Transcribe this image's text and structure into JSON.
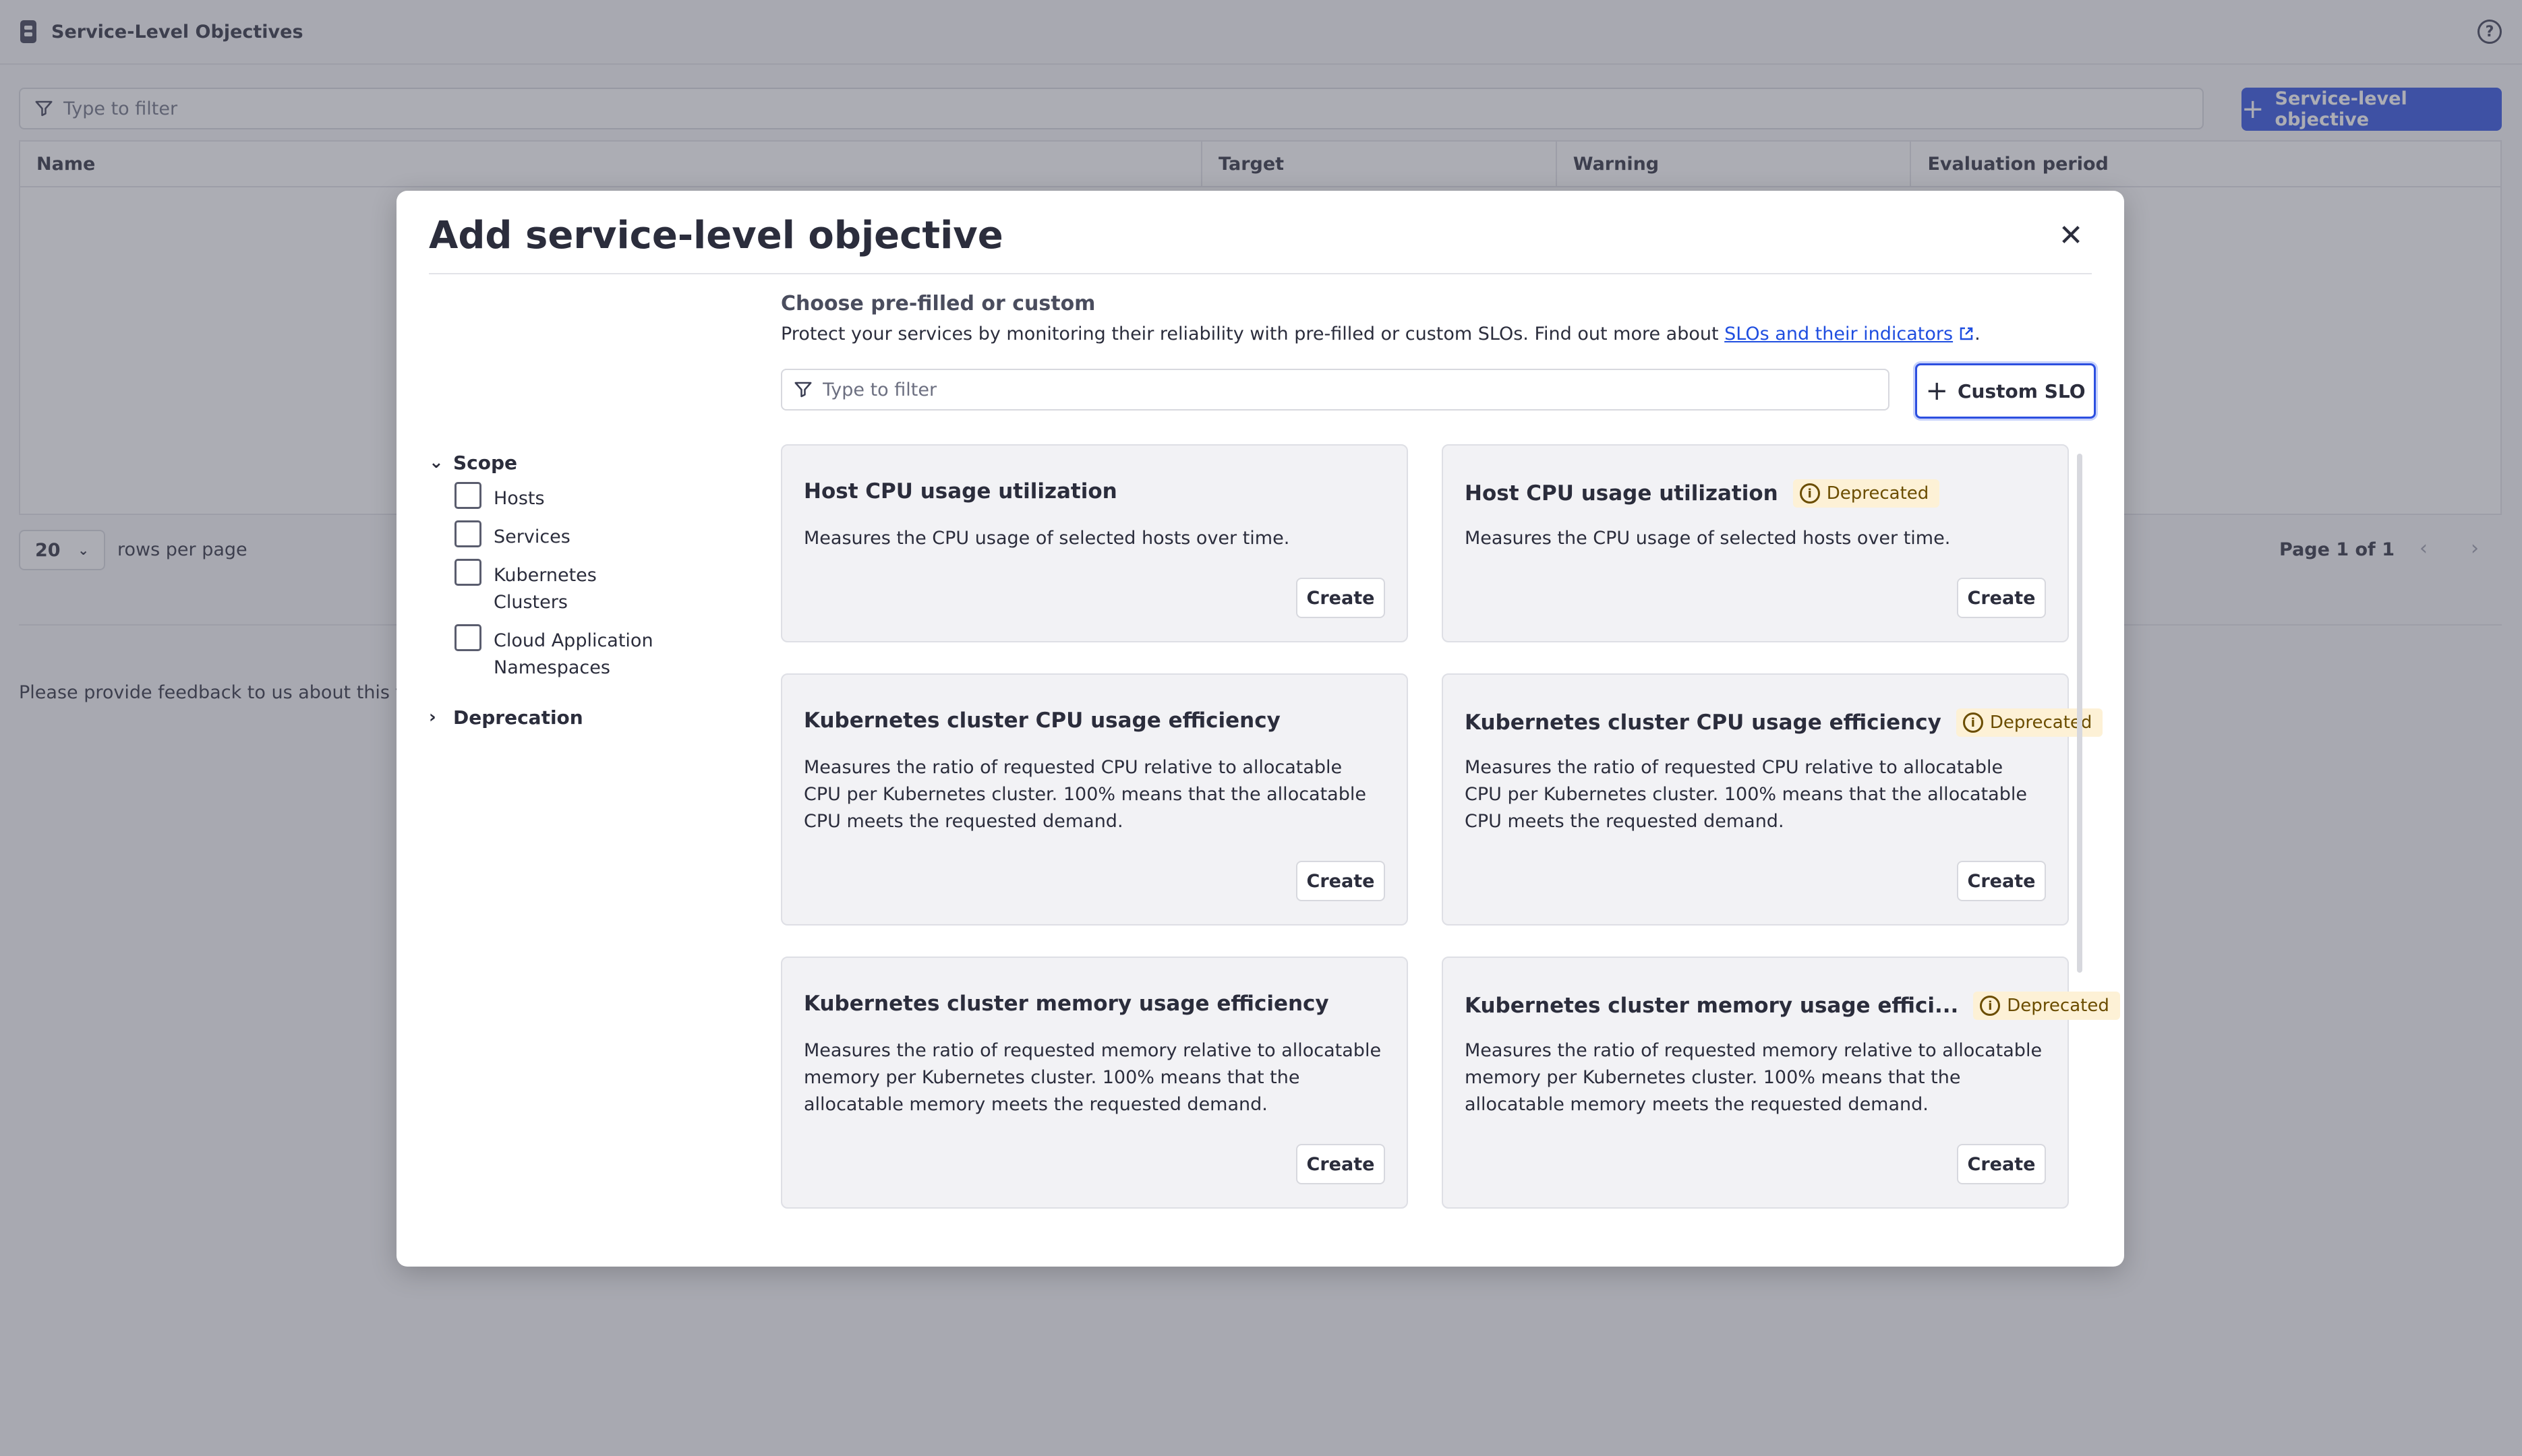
{
  "app": {
    "title": "Service-Level Objectives",
    "filter_placeholder": "Type to filter",
    "add_button": "Service-level objective",
    "columns": [
      "Name",
      "Target",
      "Warning",
      "Evaluation period"
    ],
    "rows_per_page_value": "20",
    "rows_per_page_label": "rows per page",
    "page_label": "Page  1 of 1",
    "feedback": "Please provide feedback to us about this feat"
  },
  "modal": {
    "title": "Add service-level objective",
    "choose_title": "Choose pre-filled or custom",
    "choose_desc": "Protect your services by monitoring their reliability with pre-filled or custom SLOs. Find out more about ",
    "choose_link": "SLOs and their indicators",
    "choose_desc_end": ".",
    "filter_placeholder": "Type to filter",
    "custom_button": "Custom SLO",
    "sidebar": {
      "scope_label": "Scope",
      "scope_items": [
        "Hosts",
        "Services",
        "Kubernetes Clusters",
        "Cloud Application Namespaces"
      ],
      "deprecation_label": "Deprecation"
    },
    "cards": [
      {
        "title": "Host CPU usage utilization",
        "desc": "Measures the CPU usage of selected hosts over time.",
        "deprecated": false,
        "button": "Create"
      },
      {
        "title": "Host CPU usage utilization",
        "desc": "Measures the CPU usage of selected hosts over time.",
        "deprecated": true,
        "badge": "Deprecated",
        "button": "Create"
      },
      {
        "title": "Kubernetes cluster CPU usage efficiency",
        "desc": "Measures the ratio of requested CPU relative to allocatable CPU per Kubernetes cluster. 100% means that the allocatable CPU meets the requested demand.",
        "deprecated": false,
        "button": "Create"
      },
      {
        "title": "Kubernetes cluster CPU usage efficiency",
        "desc": "Measures the ratio of requested CPU relative to allocatable CPU per Kubernetes cluster. 100% means that the allocatable CPU meets the requested demand.",
        "deprecated": true,
        "badge": "Deprecated",
        "button": "Create"
      },
      {
        "title": "Kubernetes cluster memory usage efficiency",
        "desc": "Measures the ratio of requested memory relative to allocatable memory per Kubernetes cluster. 100% means that the allocatable memory meets the requested demand.",
        "deprecated": false,
        "button": "Create"
      },
      {
        "title": "Kubernetes cluster memory usage effici...",
        "desc": "Measures the ratio of requested memory relative to allocatable memory per Kubernetes cluster. 100% means that the allocatable memory meets the requested demand.",
        "deprecated": true,
        "badge": "Deprecated",
        "button": "Create"
      }
    ]
  }
}
